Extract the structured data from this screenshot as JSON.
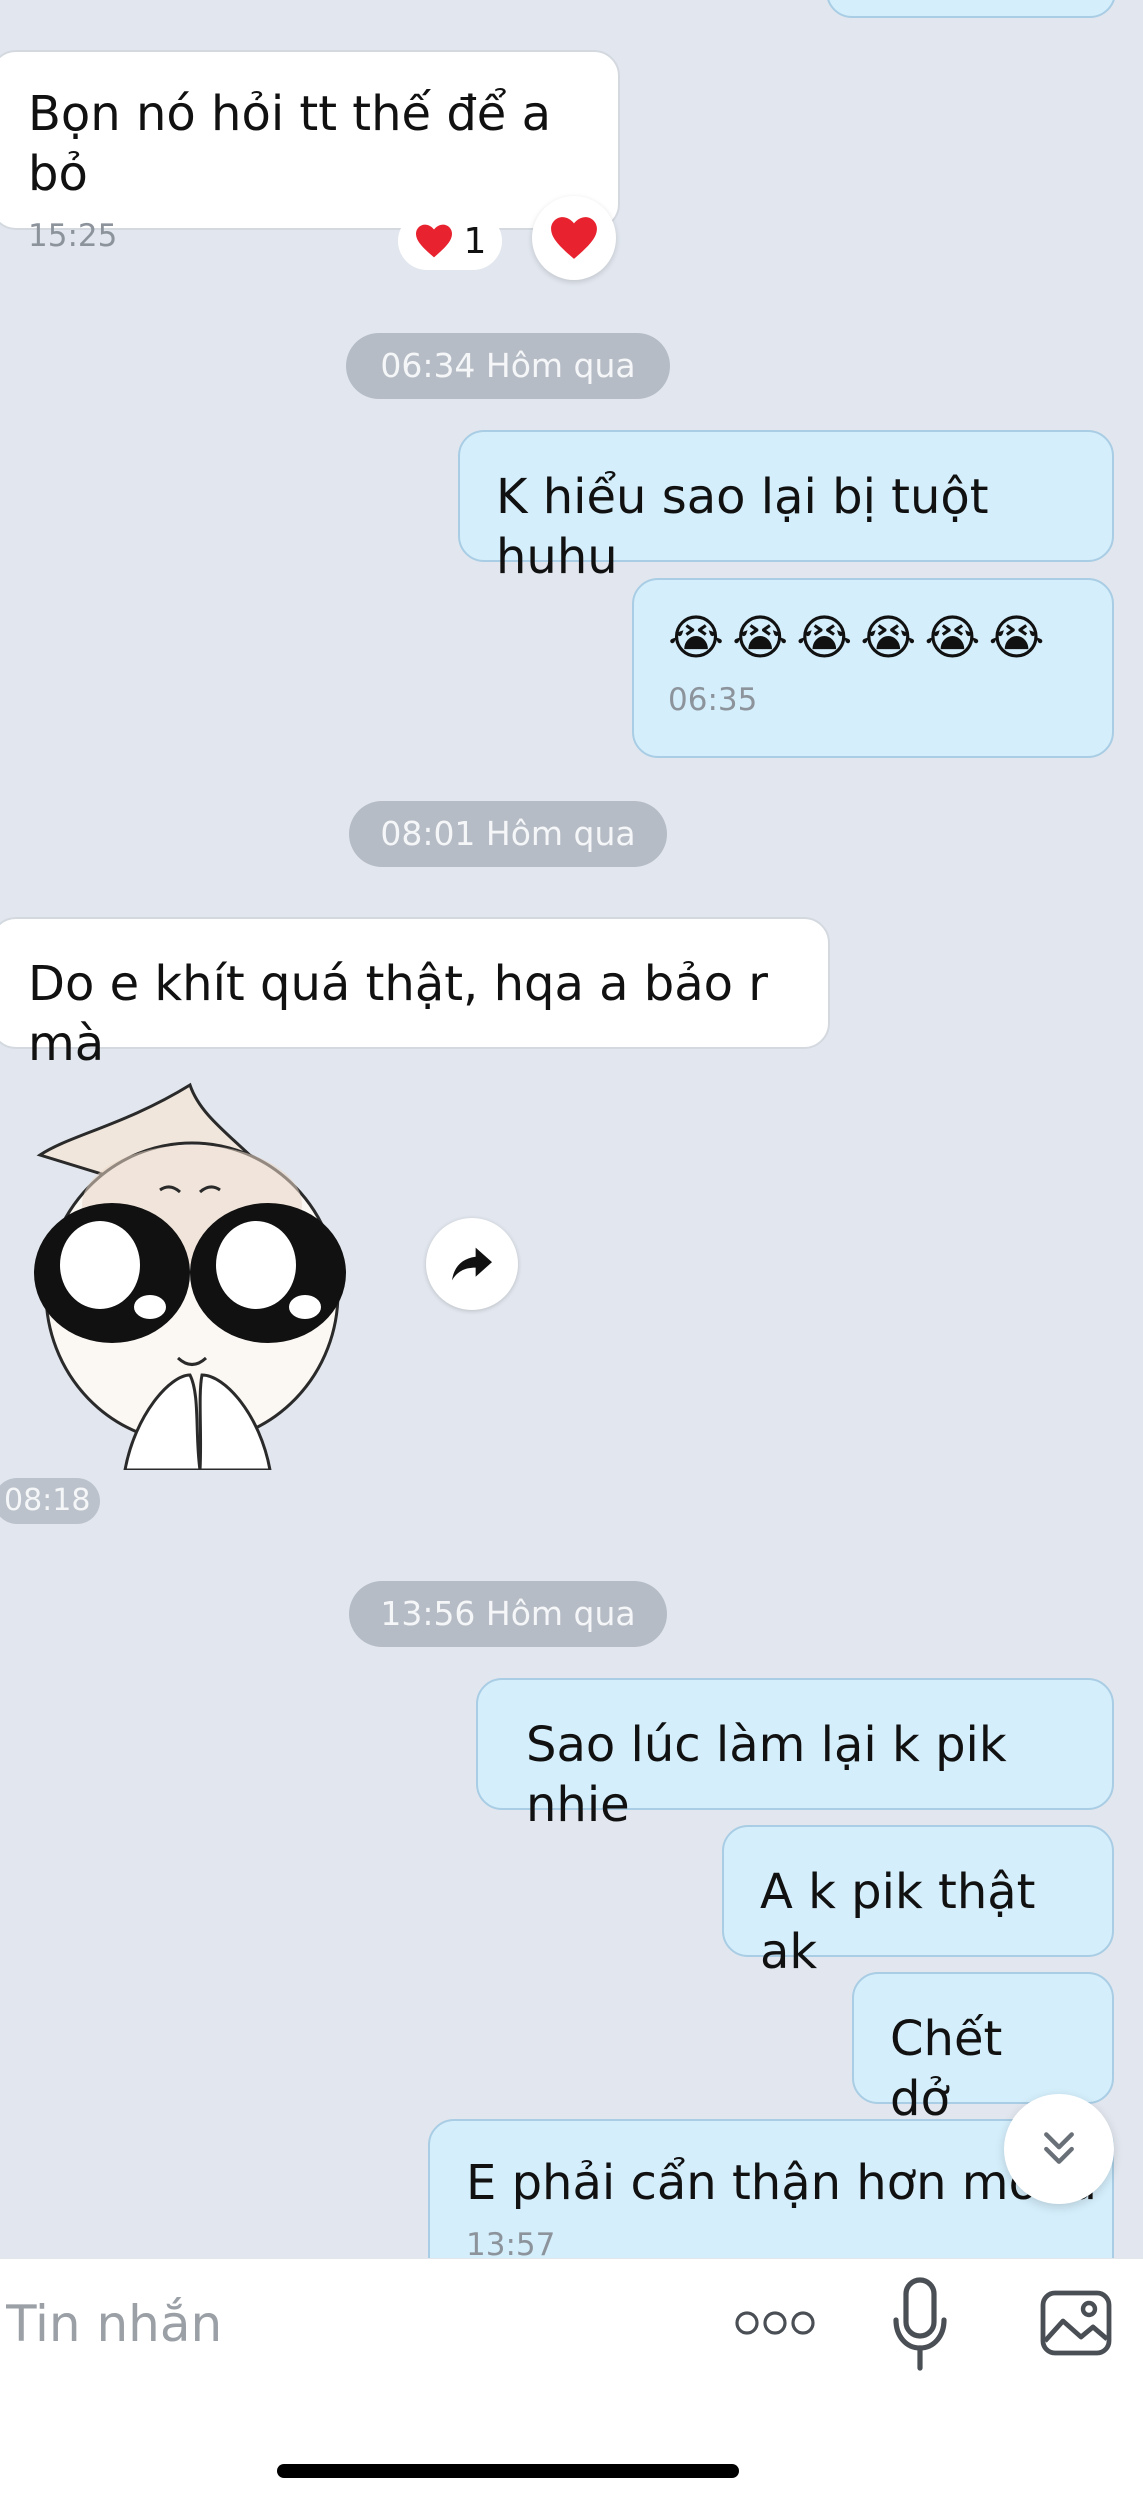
{
  "messages": {
    "m1": {
      "text": "Bọn nó hỏi tt thế để a bỏ",
      "time": "15:25"
    },
    "reaction": {
      "count": "1"
    },
    "divider1": "06:34 Hôm qua",
    "m2": {
      "text": "K hiểu sao lại bị tuột huhu"
    },
    "m3": {
      "emoji": [
        "😭",
        "😭",
        "😭",
        "😭",
        "😭",
        "😭"
      ],
      "time": "06:35"
    },
    "divider2": "08:01 Hôm qua",
    "m4": {
      "text": "Do e khít quá thật, hqa a bảo r mà"
    },
    "sticker": {
      "time": "08:18"
    },
    "divider3": "13:56 Hôm qua",
    "m5": {
      "text": "Sao lúc làm lại k pik nhie"
    },
    "m6": {
      "text": "A k pik thật ak"
    },
    "m7": {
      "text": "Chết dở"
    },
    "m8": {
      "text": "E phải cẩn thận hơn mới đ",
      "time": "13:57"
    }
  },
  "composer": {
    "placeholder": "Tin nhắn"
  },
  "icons": {
    "reaction_heart": "heart-icon",
    "share": "share-arrow-icon",
    "scroll": "double-chevron-down-icon",
    "more": "more-dots-icon",
    "mic": "microphone-icon",
    "gallery": "image-icon"
  },
  "colors": {
    "background": "#e2e7ef",
    "incoming_bubble": "#ffffff",
    "outgoing_bubble": "#d4eefb",
    "heart": "#e8232f"
  }
}
